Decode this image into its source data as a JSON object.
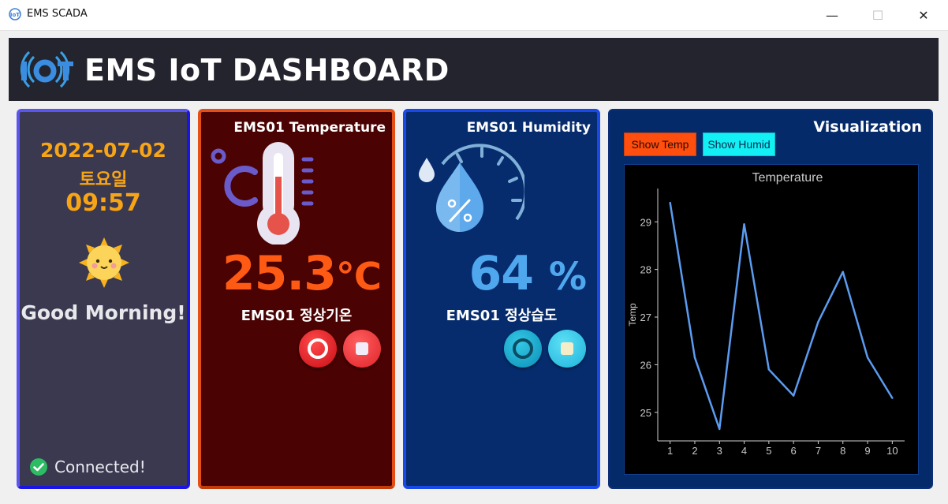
{
  "window": {
    "title": "EMS SCADA",
    "controls": {
      "minimize": "—",
      "maximize": "☐",
      "close": "✕"
    }
  },
  "header": {
    "logo_icon": "iot-logo-icon",
    "title": "EMS IoT DASHBOARD"
  },
  "date_panel": {
    "date": "2022-07-02",
    "day_of_week": "토요일",
    "time": "09:57",
    "weather_icon": "sun-icon",
    "greeting": "Good Morning!",
    "connection_status": "Connected!"
  },
  "temperature_panel": {
    "title": "EMS01 Temperature",
    "value": "25.3",
    "unit": "℃",
    "status": "EMS01 정상기온",
    "accent": "#ff5a14"
  },
  "humidity_panel": {
    "title": "EMS01 Humidity",
    "value": "64",
    "unit": "%",
    "status": "EMS01 정상습도",
    "accent": "#4fa8ee"
  },
  "visualization": {
    "title": "Visualization",
    "show_temp_label": "Show Temp",
    "show_humid_label": "Show Humid"
  },
  "chart_data": {
    "type": "line",
    "title": "Temperature",
    "ylabel": "Temp",
    "xlabel": "",
    "x": [
      1,
      2,
      3,
      4,
      5,
      6,
      7,
      8,
      9,
      10
    ],
    "series": [
      {
        "values": [
          29.4,
          26.15,
          24.65,
          28.95,
          25.9,
          25.35,
          26.9,
          27.95,
          26.15,
          25.3
        ]
      }
    ],
    "xlim": [
      0.5,
      10.5
    ],
    "ylim": [
      24.4,
      29.7
    ],
    "yticks": [
      25,
      26,
      27,
      28,
      29
    ],
    "xticks": [
      1,
      2,
      3,
      4,
      5,
      6,
      7,
      8,
      9,
      10
    ],
    "line_color": "#5b9cf0",
    "background": "#000000",
    "grid": false
  }
}
